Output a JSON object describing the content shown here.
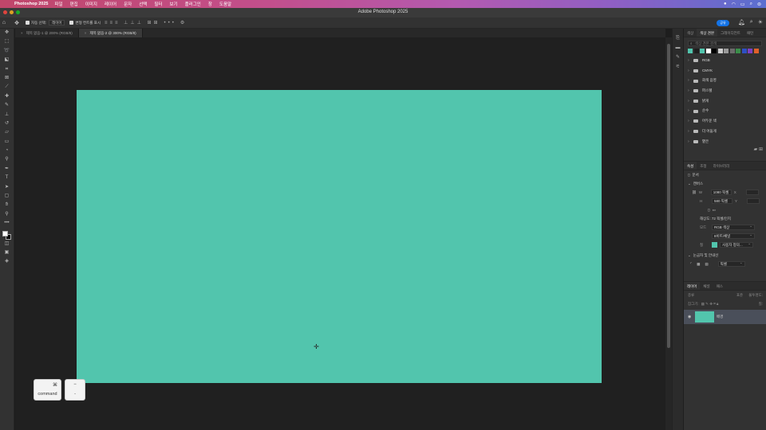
{
  "menubar": {
    "app_name": "Photoshop 2025",
    "items": [
      "파일",
      "편집",
      "이미지",
      "레이어",
      "문자",
      "선택",
      "필터",
      "보기",
      "플러그인",
      "창",
      "도움말"
    ],
    "status_icons": [
      "apple-icon",
      "wifi-icon",
      "battery-icon",
      "search-icon",
      "control-center-icon"
    ]
  },
  "window": {
    "title": "Adobe Photoshop 2025"
  },
  "options_bar": {
    "auto_select_label": "자동 선택:",
    "auto_select_value": "레이어",
    "transform_label": "변형 컨트롤 표시",
    "share_label": "공유"
  },
  "tabs": [
    {
      "label": "제목 없음-1 @ 200% (RGB/8)",
      "active": false
    },
    {
      "label": "제목 없음-2 @ 300% (RGB/8)",
      "active": true
    }
  ],
  "canvas": {
    "fill_color": "#52c5ad"
  },
  "keystrokes": [
    {
      "symbol": "⌘",
      "label": "command"
    },
    {
      "symbol": "−",
      "label": "-"
    }
  ],
  "swatches_panel": {
    "tabs": [
      "색상",
      "색상 견본",
      "그레이디언트",
      "패턴"
    ],
    "search_placeholder": "색상 견본 검색",
    "recent_colors": [
      "#52c5ad",
      "#1e1e1e",
      "#52c5ad",
      "#ffffff",
      "#000000",
      "#cfcfcf",
      "#9a9a9a",
      "#6b6b6b",
      "#3a8d4a",
      "#2e4fc4",
      "#7c3fc4",
      "#e0602a"
    ],
    "groups": [
      "RGB",
      "CMYK",
      "회색 음영",
      "파스텔",
      "밝게",
      "순수",
      "어두운 색",
      "더 어둡게",
      "옅은"
    ]
  },
  "properties_panel": {
    "tabs": [
      "속성",
      "조정",
      "라이브러리"
    ],
    "doc_label": "문서",
    "canvas_header": "캔버스",
    "width_label": "W",
    "width_value": "1080 픽셀",
    "height_label": "H",
    "height_value": "580 픽셀",
    "x_label": "X",
    "y_label": "Y",
    "resolution": "해상도: 72 픽셀/인치",
    "mode_label": "모드",
    "mode_value": "RGB 색상",
    "depth_value": "8비트/채널",
    "fill_label": "칠",
    "fill_value": "사용자 정의...",
    "guides_header": "눈금자 및 안내선",
    "unit_value": "픽셀"
  },
  "layers_panel": {
    "tabs": [
      "레이어",
      "채널",
      "패스"
    ],
    "kind_label": "종류",
    "blend_mode": "표준",
    "opacity_label": "불투명도:",
    "lock_label": "잠그기:",
    "fill_label": "칠:",
    "layers": [
      {
        "name": "배경",
        "visible": true
      }
    ]
  }
}
